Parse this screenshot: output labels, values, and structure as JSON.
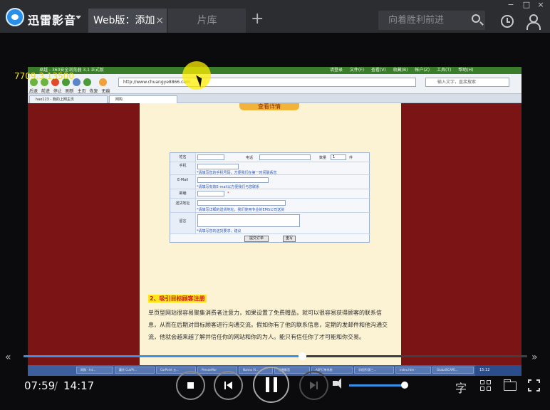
{
  "titlebar": {
    "app_name": "迅雷影音",
    "tabs": [
      {
        "label": "Web版：添加"
      },
      {
        "label": "片库"
      }
    ],
    "new_tab_icon": "plus-icon",
    "search": {
      "placeholder": "向着胜利前进"
    },
    "window_buttons": {
      "minimize": "−",
      "maximize": "□",
      "close": "×"
    },
    "tab_close": "×",
    "colors": {
      "brand": "#2a8fe8",
      "bar": "#2b2d31"
    }
  },
  "video": {
    "watermark": "7709.3.13500",
    "screen": {
      "window_title": "卓越 - 360安全浏览器 3.1 正式版",
      "menu": "请登录 文件(F) 查看(V) 收藏(B) 帐户(Z) 工具(T) 帮助(H)",
      "toolbar_labels": "后退 前进 停止 刷新 主页 恢复 无痕",
      "address_url": "http://www.chuangye8866.com",
      "search_placeholder": "输入文字，直接搜索",
      "tabs": [
        "hao123 - 我的上网主页",
        "网购"
      ],
      "page_header": "查看详情",
      "form": {
        "name_label": "姓名",
        "phone_label": "电话",
        "qty_label": "数量",
        "qty_value": "1",
        "qty_unit": "件",
        "mobile_label": "手机",
        "mobile_hint": "*请填写您的手机号码，方便我们在第一时间联系您",
        "email_label": "E-Mail",
        "email_hint": "*请填写有效E-mail以方便我们与您联系",
        "zip_label": "邮编",
        "zip_mark": "*",
        "address_label": "送货地址",
        "address_hint": "*请填写详细的送货地址，我们使用专业的EMS公司送货",
        "message_label": "留言",
        "message_hint": "*请填写您的送货要求，建议",
        "submit_label": "提交订单",
        "reset_label": "重写"
      },
      "article_heading": "2、吸引目标顾客注册",
      "article_text": "单页型网站很容易聚集消费者注意力，如果设置了免费赠品，就可以很容易获得顾客的联系信息，从而在后期对目标顾客进行沟通交流。假如你有了他的联系信息，定期的发邮件和他沟通交流，他就会越来越了解并信任你的网站和你的为人。能只有信任你了才可能和你交易。",
      "taskbar_items": [
        "网购 - Int...",
        "赢余 Cut/Pr...",
        "CarPoint 五...",
        "PresonMor",
        "Nanno Vi...",
        "迅雷影音",
        "ASP订单系统",
        "学程序(第三...",
        "index.htm -",
        "GlobalSCAPE..."
      ],
      "tray_time": "15:12"
    }
  },
  "controls": {
    "progress_fraction": 0.5537,
    "time_current": "07:59",
    "time_sep": "/",
    "time_total": "14:17",
    "volume_fraction": 0.98,
    "subtitle_label": "字",
    "prev_frame_icon": "«",
    "next_frame_icon": "»",
    "icons": [
      "stop-icon",
      "previous-icon",
      "pause-icon",
      "next-icon",
      "volume-icon",
      "playlist-icon",
      "folder-icon",
      "fullscreen-icon"
    ],
    "colors": {
      "accent": "#3a8fe6"
    }
  }
}
